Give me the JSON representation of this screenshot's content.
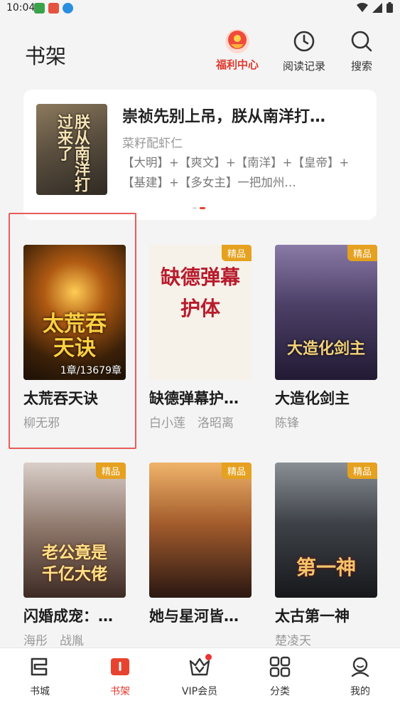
{
  "status": {
    "time": "10:04"
  },
  "header": {
    "title": "书架",
    "welfare_label": "福利中心",
    "history_label": "阅读记录",
    "search_label": "搜索"
  },
  "banner": {
    "title": "崇祯先别上吊，朕从南洋打…",
    "author": "菜籽配虾仁",
    "description": "【大明】+【爽文】+【南洋】+【皇帝】+【基建】+【多女主】一把加州…",
    "cover_text": "朕从南洋打过来了"
  },
  "books": [
    {
      "title": "太荒吞天诀",
      "author": "柳无邪",
      "progress": "1章/13679章",
      "cover_text": "太荒吞天诀",
      "tag": ""
    },
    {
      "title": "缺德弹幕护…",
      "author": "白小莲　洛昭离",
      "progress": "",
      "cover_text": "缺德弹幕护体",
      "tag": "精品"
    },
    {
      "title": "大造化剑主",
      "author": "陈锋",
      "progress": "",
      "cover_text": "大造化剑主",
      "tag": "精品"
    },
    {
      "title": "闪婚成宠：…",
      "author": "海彤　战胤",
      "progress": "",
      "cover_text": "老公竟是千亿大佬",
      "tag": "精品"
    },
    {
      "title": "她与星河皆…",
      "author": "",
      "progress": "",
      "cover_text": "",
      "tag": "精品"
    },
    {
      "title": "太古第一神",
      "author": "楚凌天",
      "progress": "",
      "cover_text": "第一神",
      "tag": "精品"
    }
  ],
  "tabs": [
    {
      "label": "书城",
      "icon": "store-icon"
    },
    {
      "label": "书架",
      "icon": "bookshelf-icon"
    },
    {
      "label": "VIP会员",
      "icon": "vip-crown-icon"
    },
    {
      "label": "分类",
      "icon": "category-icon"
    },
    {
      "label": "我的",
      "icon": "profile-icon"
    }
  ],
  "colors": {
    "accent": "#e03a2d",
    "tag": "#e5a11f"
  }
}
